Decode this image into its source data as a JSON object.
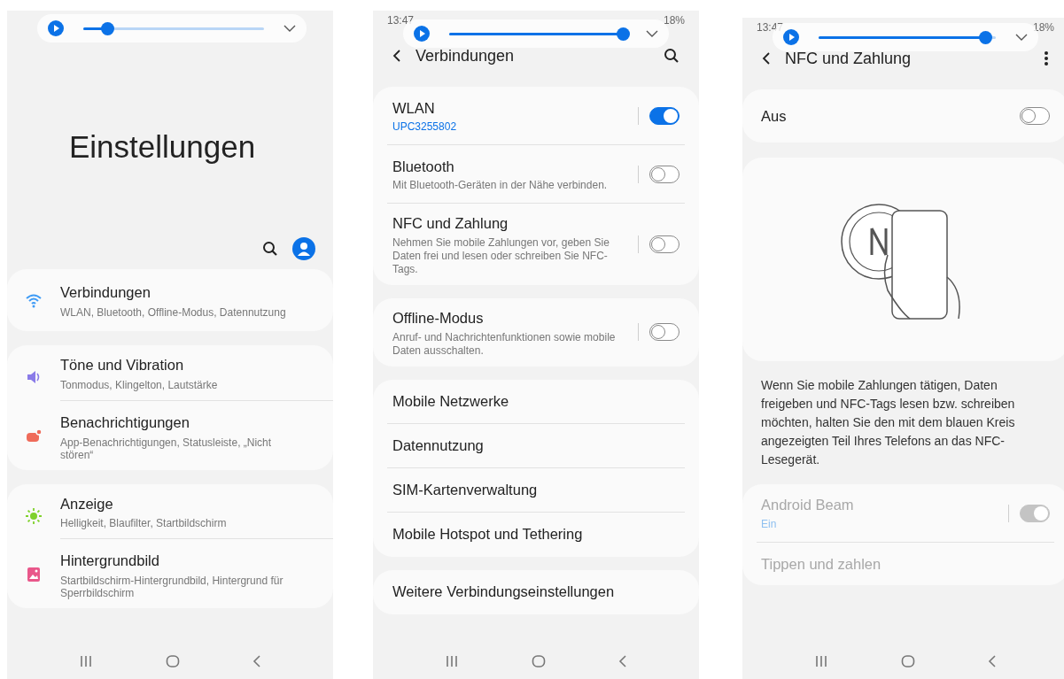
{
  "main_screen": {
    "media": {
      "level": 0.13
    },
    "title": "Einstellungen",
    "groups": [
      [
        {
          "title": "Verbindungen",
          "subtitle": "WLAN, Bluetooth, Offline-Modus, Datennutzung"
        }
      ],
      [
        {
          "title": "Töne und Vibration",
          "subtitle": "Tonmodus, Klingelton, Lautstärke"
        },
        {
          "title": "Benachrichtigungen",
          "subtitle": "App-Benachrichtigungen, Statusleiste, „Nicht stören“"
        }
      ],
      [
        {
          "title": "Anzeige",
          "subtitle": "Helligkeit, Blaufilter, Startbildschirm"
        },
        {
          "title": "Hintergrundbild",
          "subtitle": "Startbildschirm-Hintergrundbild, Hintergrund für Sperrbildschirm"
        }
      ]
    ]
  },
  "connections_screen": {
    "status": {
      "time": "13:47",
      "battery": "18%"
    },
    "media": {
      "level": 0.98
    },
    "title": "Verbindungen",
    "groups": [
      [
        {
          "kind": "toggle",
          "title": "WLAN",
          "subtitle": "UPC3255802",
          "subtitle_active": true,
          "on": true
        },
        {
          "kind": "toggle",
          "title": "Bluetooth",
          "subtitle": "Mit Bluetooth-Geräten in der Nähe verbinden.",
          "subtitle_active": false,
          "on": false
        },
        {
          "kind": "toggle",
          "title": "NFC und Zahlung",
          "subtitle": "Nehmen Sie mobile Zahlungen vor, geben Sie Daten frei und lesen oder schreiben Sie NFC-Tags.",
          "subtitle_active": false,
          "on": false
        }
      ],
      [
        {
          "kind": "toggle",
          "title": "Offline-Modus",
          "subtitle": "Anruf- und Nachrichtenfunktionen sowie mobile Daten ausschalten.",
          "subtitle_active": false,
          "on": false
        }
      ],
      [
        {
          "kind": "link",
          "title": "Mobile Netzwerke"
        },
        {
          "kind": "link",
          "title": "Datennutzung"
        },
        {
          "kind": "link",
          "title": "SIM-Kartenverwaltung"
        },
        {
          "kind": "link",
          "title": "Mobile Hotspot und Tethering"
        }
      ],
      [
        {
          "kind": "link",
          "title": "Weitere Verbindungseinstellungen"
        }
      ]
    ]
  },
  "nfc_screen": {
    "status": {
      "time": "13:47",
      "battery": "18%"
    },
    "media": {
      "level": 0.94
    },
    "title": "NFC und Zahlung",
    "master": {
      "label": "Aus",
      "on": false
    },
    "description": "Wenn Sie mobile Zahlungen tätigen, Daten freigeben und NFC-Tags lesen bzw. schreiben möchten, halten Sie den mit dem blauen Kreis angezeigten Teil Ihres Telefons an das NFC-Lesegerät.",
    "items": [
      {
        "kind": "toggle",
        "title": "Android Beam",
        "subtitle": "Ein",
        "on": true,
        "disabled": true
      },
      {
        "kind": "link",
        "title": "Tippen und zahlen",
        "disabled": true
      }
    ]
  }
}
